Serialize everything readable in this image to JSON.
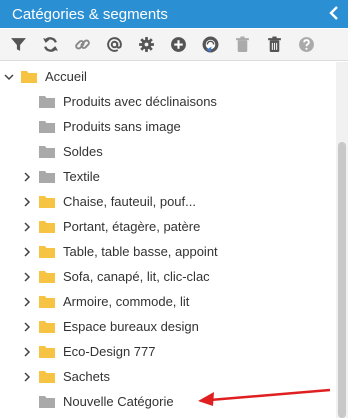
{
  "header": {
    "title": "Catégories & segments",
    "collapse_icon": "chevron-left-icon"
  },
  "toolbar": {
    "icons": [
      "filter-icon",
      "refresh-icon",
      "link-icon",
      "at-icon",
      "gear-icon",
      "add-circle-icon",
      "sync-icon",
      "trash-icon",
      "delete-icon",
      "help-icon"
    ]
  },
  "tree": {
    "root": {
      "label": "Accueil",
      "expanded": true
    },
    "items": [
      {
        "label": "Produits avec déclinaisons",
        "type": "gray",
        "expandable": false
      },
      {
        "label": "Produits sans image",
        "type": "gray",
        "expandable": false
      },
      {
        "label": "Soldes",
        "type": "gray",
        "expandable": false
      },
      {
        "label": "Textile",
        "type": "gray",
        "expandable": true
      },
      {
        "label": "Chaise, fauteuil, pouf...",
        "type": "yellow",
        "expandable": true
      },
      {
        "label": "Portant, étagère, patère",
        "type": "yellow",
        "expandable": true
      },
      {
        "label": "Table, table basse, appoint",
        "type": "yellow",
        "expandable": true
      },
      {
        "label": "Sofa, canapé, lit, clic-clac",
        "type": "yellow",
        "expandable": true
      },
      {
        "label": "Armoire, commode, lit",
        "type": "yellow",
        "expandable": true
      },
      {
        "label": "Espace bureaux design",
        "type": "yellow",
        "expandable": true
      },
      {
        "label": "Eco-Design 777",
        "type": "yellow",
        "expandable": true
      },
      {
        "label": "Sachets",
        "type": "yellow",
        "expandable": true
      },
      {
        "label": "Nouvelle Catégorie",
        "type": "gray",
        "expandable": false
      }
    ]
  },
  "colors": {
    "header": "#2b8fd4",
    "folder_yellow": "#f6c342",
    "folder_gray": "#a9a9a9",
    "arrow": "#e02020"
  }
}
